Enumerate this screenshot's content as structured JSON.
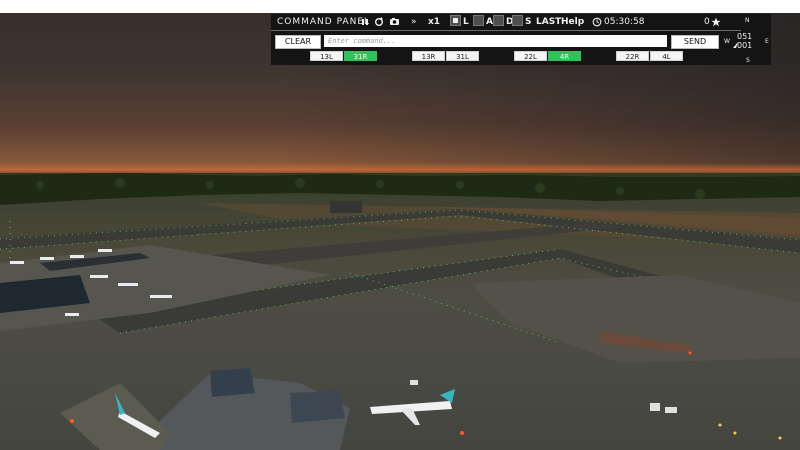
{
  "panel": {
    "title": "COMMAND PANEL",
    "pause_icon": "pause-icon",
    "reset_icon": "reset-icon",
    "camera_icon": "camera-icon",
    "ffwd_label": "»",
    "speed": "x1",
    "layers": [
      {
        "key": "L",
        "checked": true
      },
      {
        "key": "A",
        "checked": false
      },
      {
        "key": "D",
        "checked": false
      },
      {
        "key": "S",
        "checked": false
      }
    ],
    "last_label": "LAST",
    "help_label": "Help",
    "clock": "05:30:58",
    "score": "0",
    "star_icon": "star-icon",
    "clock_icon": "clock-icon",
    "clear_label": "CLEAR",
    "command_placeholder": "Enter command...",
    "send_label": "SEND",
    "runways": [
      {
        "label": "13L",
        "active": false
      },
      {
        "label": "31R",
        "active": true
      },
      {
        "label": "13R",
        "active": false
      },
      {
        "label": "31L",
        "active": false
      },
      {
        "label": "22L",
        "active": false
      },
      {
        "label": "4R",
        "active": true
      },
      {
        "label": "22R",
        "active": false
      },
      {
        "label": "4L",
        "active": false
      }
    ]
  },
  "compass": {
    "north": "N",
    "south": "S",
    "east": "E",
    "west": "W",
    "heading": "051",
    "subheading": "001",
    "arrow_icon": "heading-arrow-icon"
  },
  "colors": {
    "panel_bg": "#141414",
    "active_runway": "#2ec35a",
    "sky_glow": "#a1603a"
  }
}
